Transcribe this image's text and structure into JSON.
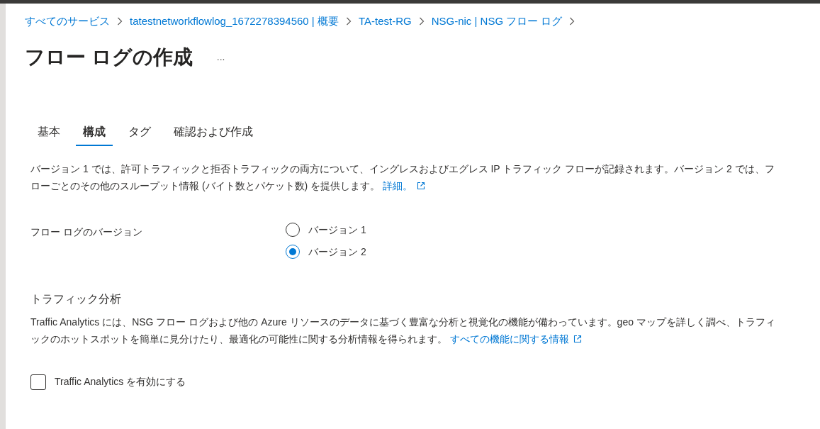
{
  "breadcrumb": [
    {
      "label": "すべてのサービス"
    },
    {
      "label": "tatestnetworkflowlog_1672278394560 | 概要"
    },
    {
      "label": "TA-test-RG"
    },
    {
      "label": "NSG-nic | NSG フロー ログ"
    }
  ],
  "title": "フロー ログの作成",
  "more_button": "...",
  "tabs": [
    {
      "label": "基本",
      "selected": false
    },
    {
      "label": "構成",
      "selected": true
    },
    {
      "label": "タグ",
      "selected": false
    },
    {
      "label": "確認および作成",
      "selected": false
    }
  ],
  "description": {
    "text": "バージョン 1 では、許可トラフィックと拒否トラフィックの両方について、イングレスおよびエグレス IP トラフィック フローが記録されます。バージョン 2 では、フローごとのその他のスループット情報 (バイト数とパケット数) を提供します。",
    "link": "詳細。"
  },
  "flow_log_version": {
    "label": "フロー ログのバージョン",
    "options": [
      {
        "label": "バージョン 1",
        "selected": false
      },
      {
        "label": "バージョン 2",
        "selected": true
      }
    ]
  },
  "traffic_analytics": {
    "heading": "トラフィック分析",
    "text": "Traffic Analytics には、NSG フロー ログおよび他の Azure リソースのデータに基づく豊富な分析と視覚化の機能が備わっています。geo マップを詳しく調べ、トラフィックのホットスポットを簡単に見分けたり、最適化の可能性に関する分析情報を得られます。",
    "link": "すべての機能に関する情報",
    "checkbox": {
      "label": "Traffic Analytics を有効にする",
      "checked": false
    }
  }
}
